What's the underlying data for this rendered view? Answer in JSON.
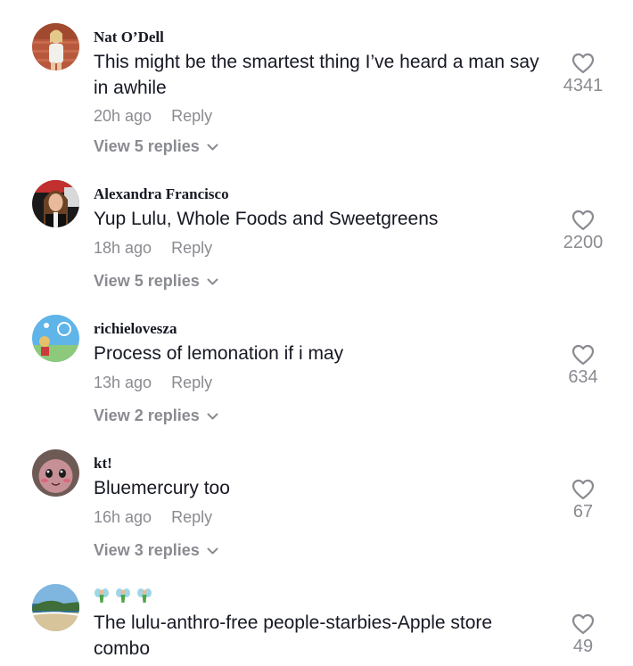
{
  "comments": [
    {
      "username": "Nat O’Dell",
      "text": "This might be the smartest thing I’ve heard a man say in awhile",
      "time": "20h ago",
      "reply_label": "Reply",
      "view_replies": "View 5 replies",
      "likes": "4341",
      "avatar_icon": "user-avatar"
    },
    {
      "username": "Alexandra Francisco",
      "text": "Yup Lulu, Whole Foods and Sweetgreens",
      "time": "18h ago",
      "reply_label": "Reply",
      "view_replies": "View 5 replies",
      "likes": "2200",
      "avatar_icon": "user-avatar"
    },
    {
      "username": "richielovesza",
      "text": "Process of lemonation if i may",
      "time": "13h ago",
      "reply_label": "Reply",
      "view_replies": "View 2 replies",
      "likes": "634",
      "avatar_icon": "user-avatar"
    },
    {
      "username": "kt!",
      "text": "Bluemercury too",
      "time": "16h ago",
      "reply_label": "Reply",
      "view_replies": "View 3 replies",
      "likes": "67",
      "avatar_icon": "user-avatar"
    },
    {
      "username_emojis": [
        "fairy-emoji",
        "fairy-emoji",
        "fairy-emoji"
      ],
      "text": "The lulu-anthro-free people-starbies-Apple store combo",
      "likes": "49",
      "avatar_icon": "user-avatar"
    }
  ],
  "icons": {
    "like": "heart-outline-icon",
    "expand": "chevron-down-icon"
  },
  "colors": {
    "primary_text": "#161823",
    "secondary_text": "#8a8b91"
  }
}
